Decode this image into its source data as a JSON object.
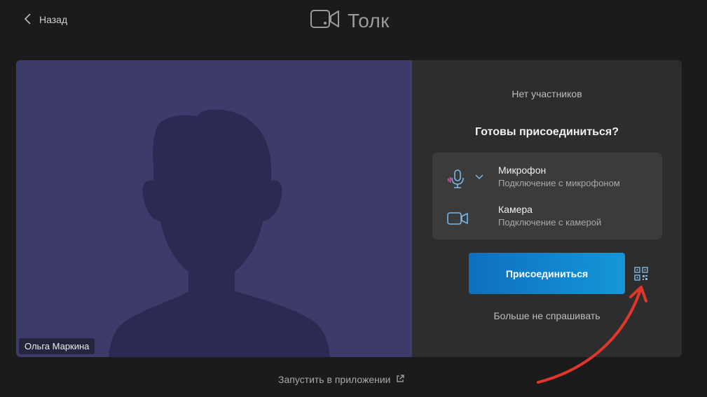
{
  "header": {
    "back_label": "Назад",
    "app_name": "Толк"
  },
  "video": {
    "participant_name": "Ольга Маркина",
    "background_color": "#3d3b6a"
  },
  "panel": {
    "participants_status": "Нет участников",
    "ready_prompt": "Готовы присоединиться?",
    "devices": [
      {
        "icon": "microphone-icon",
        "name": "Микрофон",
        "status": "Подключение с микрофоном"
      },
      {
        "icon": "camera-icon",
        "name": "Камера",
        "status": "Подключение с камерой"
      }
    ],
    "join_label": "Присоединиться",
    "dont_ask_label": "Больше не спрашивать",
    "qr_icon": "qr-code-icon"
  },
  "footer": {
    "launch_app_label": "Запустить в приложении"
  },
  "colors": {
    "background": "#1b1b1b",
    "panel": "#2d2d2d",
    "accent": "#1497d8",
    "annotation": "#e0372b"
  }
}
